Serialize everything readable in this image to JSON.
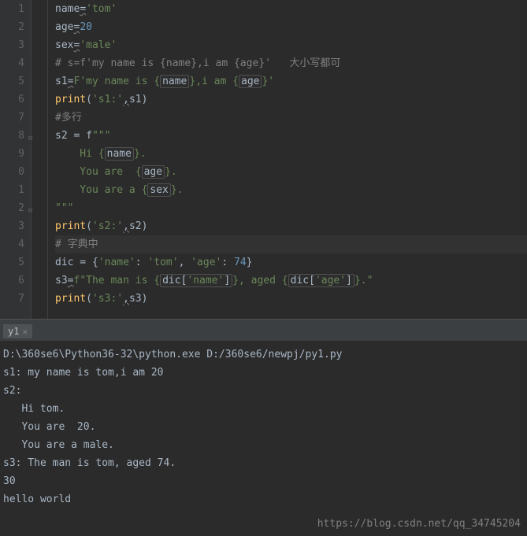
{
  "lineNumbers": [
    "1",
    "2",
    "3",
    "4",
    "5",
    "6",
    "7",
    "8",
    "9",
    "0",
    "1",
    "2",
    "3",
    "4",
    "5",
    "6",
    "7"
  ],
  "code": {
    "l1": {
      "var": "name",
      "eq": "=",
      "val": "'tom'"
    },
    "l2": {
      "var": "age",
      "eq": "=",
      "val": "20"
    },
    "l3": {
      "var": "sex",
      "eq": "=",
      "val": "'male'"
    },
    "l4": {
      "text": "# s=f'my name is {name},i am {age}'   大小写都可"
    },
    "l5": {
      "var": "s1",
      "eq": "=",
      "p1": "F",
      "s1": "'my name is {",
      "b1": "name",
      "s2": "},i am {",
      "b2": "age",
      "s3": "}'"
    },
    "l6": {
      "fn": "print",
      "op1": "(",
      "s1": "'s1:'",
      "com": ",",
      "s2": "s1",
      "op2": ")"
    },
    "l7": {
      "text": "#多行"
    },
    "l8": {
      "var": "s2 = f",
      "q": "\"\"\""
    },
    "l9": {
      "s1": "    Hi {",
      "b": "name",
      "s2": "}."
    },
    "l10": {
      "s1": "    You are  {",
      "b": "age",
      "s2": "}."
    },
    "l11": {
      "s1": "    You are a {",
      "b": "sex",
      "s2": "}."
    },
    "l12": {
      "q": "\"\"\""
    },
    "l13": {
      "fn": "print",
      "op1": "(",
      "s1": "'s2:'",
      "com": ",",
      "s2": "s2",
      "op2": ")"
    },
    "l14": {
      "text": "# 字典中"
    },
    "l15": {
      "p1": "dic = {",
      "k1": "'name'",
      "c1": ": ",
      "v1": "'tom'",
      "c2": ", ",
      "k2": "'age'",
      "c3": ": ",
      "v2": "74",
      "p2": "}"
    },
    "l16": {
      "var": "s3",
      "eq": "=",
      "p1": "f",
      "q1": "\"",
      "s1": "The man is {",
      "b1": "dic[",
      "bk1": "'name'",
      "b1e": "]",
      "s2": "}, aged {",
      "b2": "dic[",
      "bk2": "'age'",
      "b2e": "]",
      "s3": "}.",
      "q2": "\""
    },
    "l17": {
      "fn": "print",
      "op1": "(",
      "s1": "'s3:'",
      "com": ",",
      "s2": "s3",
      "op2": ")"
    }
  },
  "tab": {
    "label": "y1",
    "close": "×"
  },
  "console": {
    "l1": "D:\\360se6\\Python36-32\\python.exe D:/360se6/newpj/py1.py",
    "l2": "s1: my name is tom,i am 20",
    "l3": "s2:",
    "l4": "   Hi tom.",
    "l5": "   You are  20.",
    "l6": "   You are a male.",
    "l7": "",
    "l8": "s3: The man is tom, aged 74.",
    "l9": "30",
    "l10": "hello world"
  },
  "watermark": "https://blog.csdn.net/qq_34745204"
}
